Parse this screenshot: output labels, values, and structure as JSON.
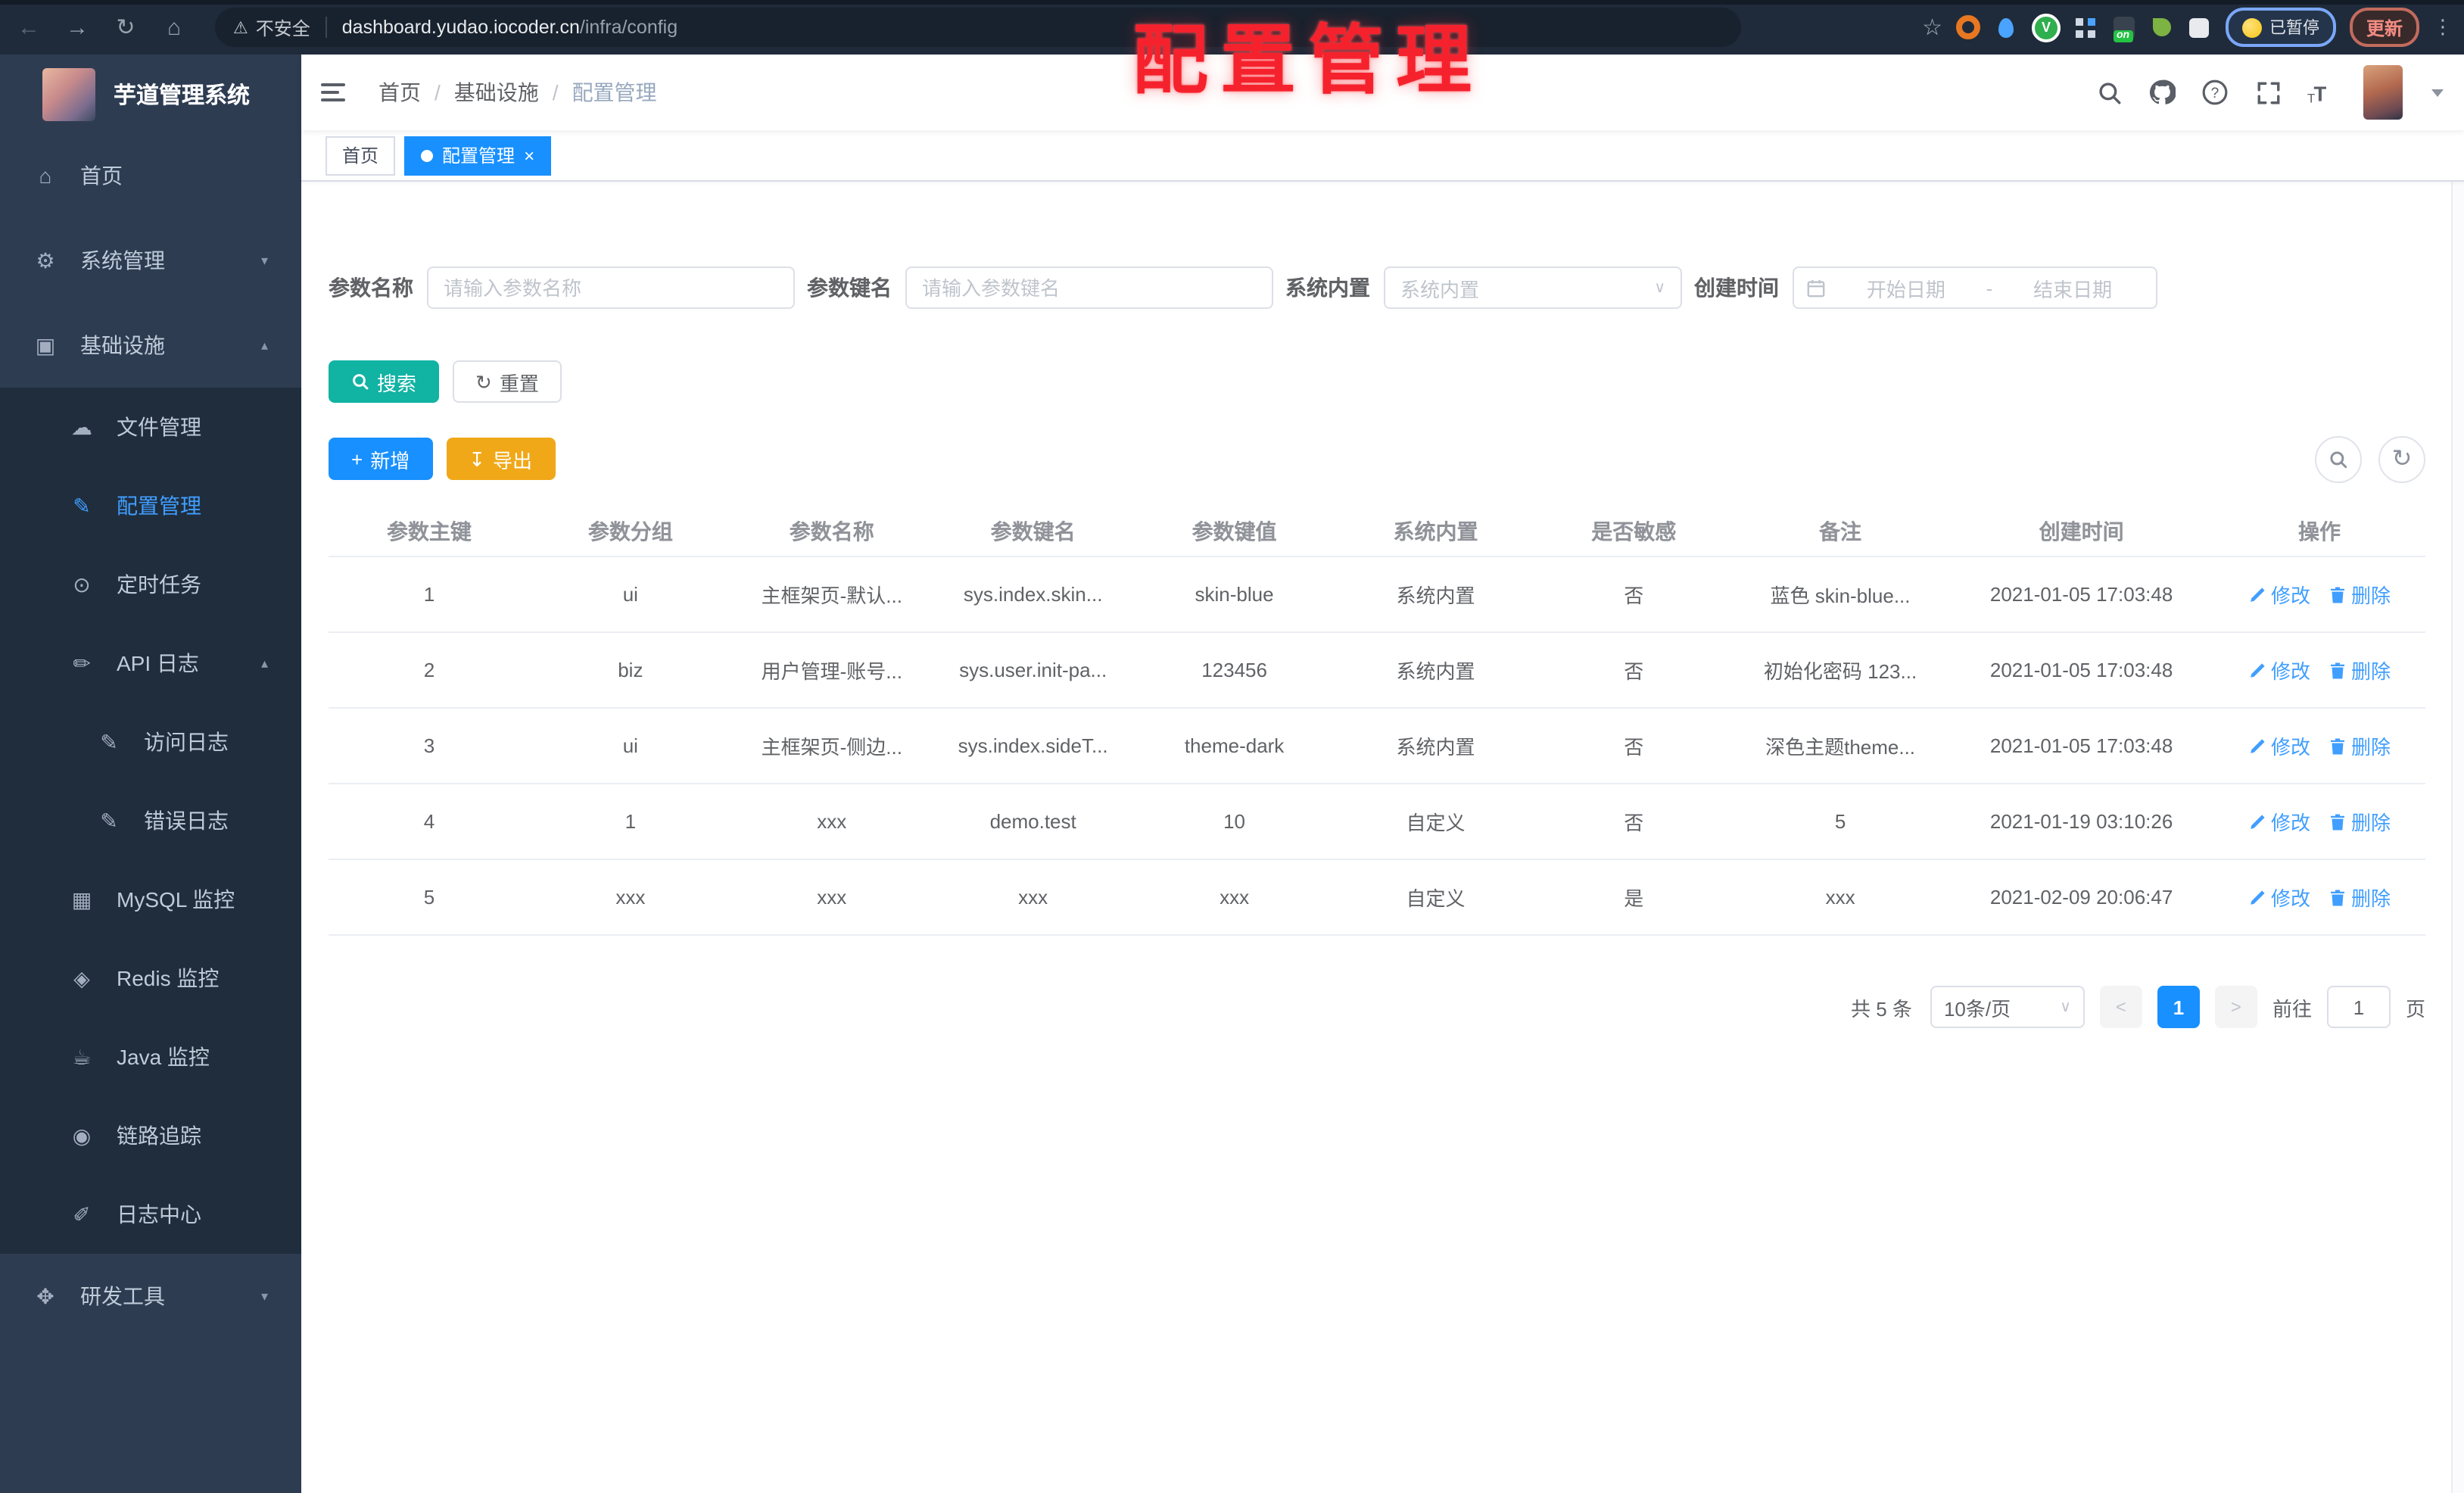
{
  "colors": {
    "accent_blue": "#1890ff",
    "link_blue": "#409eff",
    "search_button_teal": "#11b3a3",
    "export_button_orange": "#f0a818",
    "watermark_red": "#f5222d",
    "sidebar_bg": "#2e3c52",
    "submenu_bg": "#1f2d3d"
  },
  "browser": {
    "security_label": "不安全",
    "url_host": "dashboard.yudao.iocoder.cn",
    "url_path": "/infra/config",
    "ext_on_badge": "on",
    "paused_label": "已暂停",
    "update_label": "更新"
  },
  "watermark": {
    "text": "配置管理"
  },
  "sidebar": {
    "title": "芋道管理系统",
    "items": [
      {
        "label": "首页",
        "icon": "⌂",
        "icon_name": "home-icon",
        "name": "sidebar-item-home",
        "cls": "top",
        "chevron": ""
      },
      {
        "label": "系统管理",
        "icon": "⚙",
        "icon_name": "gear-icon",
        "name": "sidebar-item-system",
        "cls": "top",
        "chevron": "▾"
      },
      {
        "label": "基础设施",
        "icon": "▣",
        "icon_name": "infra-icon",
        "name": "sidebar-item-infra",
        "cls": "top",
        "chevron": "▴"
      },
      {
        "label": "文件管理",
        "icon": "☁",
        "icon_name": "cloud-icon",
        "name": "sidebar-item-file",
        "cls": "sub",
        "chevron": ""
      },
      {
        "label": "配置管理",
        "icon": "✎",
        "icon_name": "edit-icon",
        "name": "sidebar-item-config",
        "cls": "sub active",
        "chevron": ""
      },
      {
        "label": "定时任务",
        "icon": "⊙",
        "icon_name": "clock-icon",
        "name": "sidebar-item-job",
        "cls": "sub",
        "chevron": ""
      },
      {
        "label": "API 日志",
        "icon": "✏",
        "icon_name": "api-log-icon",
        "name": "sidebar-item-api-log",
        "cls": "sub",
        "chevron": "▴"
      },
      {
        "label": "访问日志",
        "icon": "✎",
        "icon_name": "access-log-icon",
        "name": "sidebar-item-access-log",
        "cls": "nested",
        "chevron": ""
      },
      {
        "label": "错误日志",
        "icon": "✎",
        "icon_name": "error-log-icon",
        "name": "sidebar-item-error-log",
        "cls": "nested",
        "chevron": ""
      },
      {
        "label": "MySQL 监控",
        "icon": "▦",
        "icon_name": "mysql-icon",
        "name": "sidebar-item-mysql",
        "cls": "sub",
        "chevron": ""
      },
      {
        "label": "Redis 监控",
        "icon": "◈",
        "icon_name": "redis-icon",
        "name": "sidebar-item-redis",
        "cls": "sub",
        "chevron": ""
      },
      {
        "label": "Java 监控",
        "icon": "☕",
        "icon_name": "java-icon",
        "name": "sidebar-item-java",
        "cls": "sub",
        "chevron": ""
      },
      {
        "label": "链路追踪",
        "icon": "◉",
        "icon_name": "eye-icon",
        "name": "sidebar-item-trace",
        "cls": "sub",
        "chevron": ""
      },
      {
        "label": "日志中心",
        "icon": "✐",
        "icon_name": "log-center-icon",
        "name": "sidebar-item-log-center",
        "cls": "sub",
        "chevron": ""
      },
      {
        "label": "研发工具",
        "icon": "✥",
        "icon_name": "tools-icon",
        "name": "sidebar-item-dev-tools",
        "cls": "top",
        "chevron": "▾"
      }
    ]
  },
  "header": {
    "breadcrumb": {
      "home": "首页",
      "section": "基础设施",
      "current": "配置管理",
      "sep": "/"
    }
  },
  "tags": {
    "items": [
      {
        "label": "首页",
        "cls": "",
        "name": "tab-home"
      },
      {
        "label": "配置管理",
        "cls": "active",
        "name": "tab-config"
      }
    ]
  },
  "filters": {
    "name_label": "参数名称",
    "name_placeholder": "请输入参数名称",
    "key_label": "参数键名",
    "key_placeholder": "请输入参数键名",
    "type_label": "系统内置",
    "type_placeholder": "系统内置",
    "date_label": "创建时间",
    "date_start_placeholder": "开始日期",
    "date_sep": "-",
    "date_end_placeholder": "结束日期",
    "search": "搜索",
    "reset": "重置",
    "add": "新增",
    "export": "导出"
  },
  "table": {
    "columns": [
      "参数主键",
      "参数分组",
      "参数名称",
      "参数键名",
      "参数键值",
      "系统内置",
      "是否敏感",
      "备注",
      "创建时间",
      "操作"
    ],
    "rows": [
      {
        "id": "1",
        "group": "ui",
        "name": "主框架页-默认...",
        "key": "sys.index.skin...",
        "value": "skin-blue",
        "type": "系统内置",
        "sensitive": "否",
        "remark": "蓝色 skin-blue...",
        "time": "2021-01-05 17:03:48"
      },
      {
        "id": "2",
        "group": "biz",
        "name": "用户管理-账号...",
        "key": "sys.user.init-pa...",
        "value": "123456",
        "type": "系统内置",
        "sensitive": "否",
        "remark": "初始化密码 123...",
        "time": "2021-01-05 17:03:48"
      },
      {
        "id": "3",
        "group": "ui",
        "name": "主框架页-侧边...",
        "key": "sys.index.sideT...",
        "value": "theme-dark",
        "type": "系统内置",
        "sensitive": "否",
        "remark": "深色主题theme...",
        "time": "2021-01-05 17:03:48"
      },
      {
        "id": "4",
        "group": "1",
        "name": "xxx",
        "key": "demo.test",
        "value": "10",
        "type": "自定义",
        "sensitive": "否",
        "remark": "5",
        "time": "2021-01-19 03:10:26"
      },
      {
        "id": "5",
        "group": "xxx",
        "name": "xxx",
        "key": "xxx",
        "value": "xxx",
        "type": "自定义",
        "sensitive": "是",
        "remark": "xxx",
        "time": "2021-02-09 20:06:47"
      }
    ],
    "actions": {
      "edit": "修改",
      "del": "删除"
    }
  },
  "pagination": {
    "total": "共 5 条",
    "page_size": "10条/页",
    "current_page": "1",
    "goto_label": "前往",
    "goto_value": "1",
    "page_unit": "页"
  }
}
